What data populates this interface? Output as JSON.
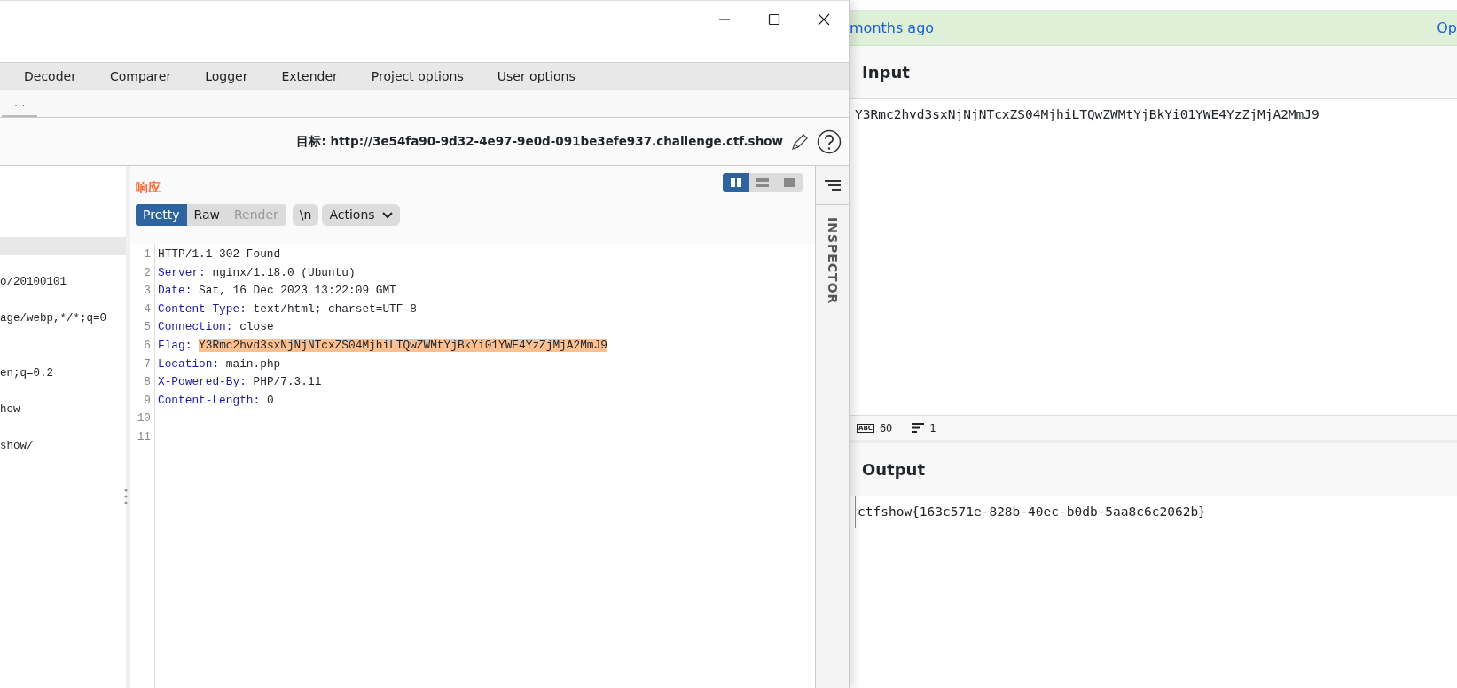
{
  "burp": {
    "tabs": [
      {
        "label": "Decoder",
        "selected": false
      },
      {
        "label": "Comparer",
        "selected": false
      },
      {
        "label": "Logger",
        "selected": false
      },
      {
        "label": "Extender",
        "selected": false
      },
      {
        "label": "Project options",
        "selected": false
      },
      {
        "label": "User options",
        "selected": false
      }
    ],
    "sub_tabs": [
      {
        "label": "...",
        "selected": true
      }
    ],
    "target": "目标: http://3e54fa90-9d32-4e97-9e0d-091be3efe937.challenge.ctf.show",
    "request_fragments": [
      "o/20100101",
      "age/webp,*/*;q=0",
      "en;q=0.2",
      "how",
      "show/"
    ],
    "response": {
      "title": "响应",
      "layout_modes": [
        {
          "selected": true
        },
        {
          "selected": false
        },
        {
          "selected": false
        }
      ],
      "view_tabs": [
        {
          "label": "Pretty",
          "selected": true,
          "disabled": false
        },
        {
          "label": "Raw",
          "selected": false,
          "disabled": false
        },
        {
          "label": "Render",
          "selected": false,
          "disabled": true
        }
      ],
      "newline_button": "\\n",
      "actions_button": "Actions",
      "lines": [
        {
          "number": "1",
          "kind": "status",
          "text": "HTTP/1.1 302 Found"
        },
        {
          "number": "2",
          "kind": "header",
          "name": "Server:",
          "value": "nginx/1.18.0 (Ubuntu)",
          "highlighted": false
        },
        {
          "number": "3",
          "kind": "header",
          "name": "Date:",
          "value": "Sat, 16 Dec 2023 13:22:09 GMT",
          "highlighted": false
        },
        {
          "number": "4",
          "kind": "header",
          "name": "Content-Type:",
          "value": "text/html; charset=UTF-8",
          "highlighted": false
        },
        {
          "number": "5",
          "kind": "header",
          "name": "Connection:",
          "value": "close",
          "highlighted": false
        },
        {
          "number": "6",
          "kind": "header",
          "name": "Flag:",
          "value": "Y3Rmc2hvd3sxNjNjNTcxZS04MjhiLTQwZWMtYjBkYi01YWE4YzZjMjA2MmJ9",
          "highlighted": true
        },
        {
          "number": "7",
          "kind": "header",
          "name": "Location:",
          "value": "main.php",
          "highlighted": false
        },
        {
          "number": "8",
          "kind": "header",
          "name": "X-Powered-By:",
          "value": "PHP/7.3.11",
          "highlighted": false
        },
        {
          "number": "9",
          "kind": "header",
          "name": "Content-Length:",
          "value": "0",
          "highlighted": false
        },
        {
          "number": "10",
          "kind": "empty"
        },
        {
          "number": "11",
          "kind": "empty"
        }
      ]
    },
    "inspector": "INSPECTOR"
  },
  "browser": {
    "notice": "months ago",
    "notice_link": "Op",
    "input": {
      "title": "Input",
      "value": "Y3Rmc2hvd3sxNjNjNTcxZS04MjhiLTQwZWMtYjBkYi01YWE4YzZjMjA2MmJ9",
      "length_icon": "ABC",
      "length": "60",
      "lines": "1"
    },
    "output": {
      "title": "Output",
      "value": "ctfshow{163c571e-828b-40ec-b0db-5aa8c6c2062b}"
    }
  }
}
